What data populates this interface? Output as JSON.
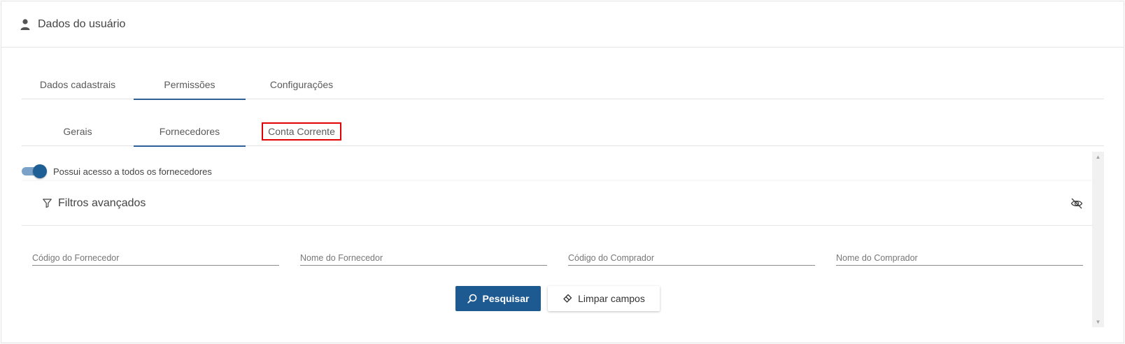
{
  "header": {
    "title": "Dados do usuário",
    "icon": "user-icon"
  },
  "main_tabs": [
    {
      "label": "Dados cadastrais"
    },
    {
      "label": "Permissões"
    },
    {
      "label": "Configurações"
    }
  ],
  "sub_tabs": [
    {
      "label": "Gerais"
    },
    {
      "label": "Fornecedores"
    },
    {
      "label": "Conta Corrente"
    }
  ],
  "toggle": {
    "label": "Possui acesso a todos os fornecedores",
    "checked": true
  },
  "filters": {
    "title": "Filtros avançados",
    "fields": [
      {
        "placeholder": "Código do Fornecedor",
        "value": ""
      },
      {
        "placeholder": "Nome do Fornecedor",
        "value": ""
      },
      {
        "placeholder": "Código do Comprador",
        "value": ""
      },
      {
        "placeholder": "Nome do Comprador",
        "value": ""
      }
    ],
    "search_label": "Pesquisar",
    "clear_label": "Limpar campos"
  },
  "colors": {
    "accent": "#1d5a91",
    "highlight": "#e00000"
  }
}
